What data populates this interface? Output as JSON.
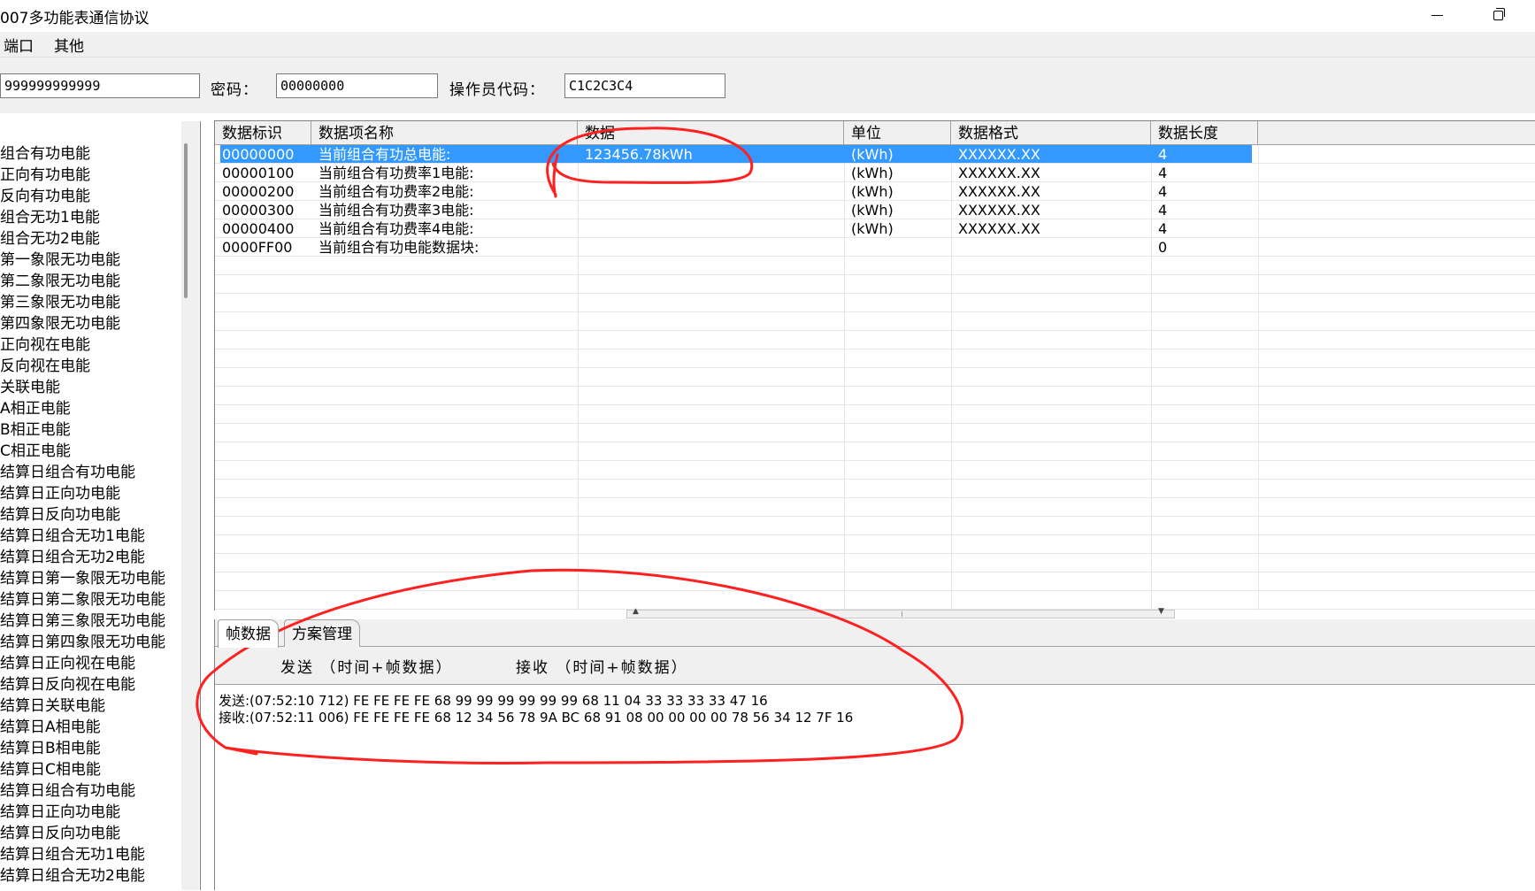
{
  "window": {
    "title": "007多功能表通信协议",
    "minimize_icon": "minimize-icon",
    "restore_icon": "restore-icon"
  },
  "menu": [
    "端口",
    "其他"
  ],
  "toolbar": {
    "address_value": "999999999999",
    "password_label": "密码：",
    "password_value": "00000000",
    "operator_label": "操作员代码：",
    "operator_value": "C1C2C3C4"
  },
  "tree": [
    "组合有功电能",
    "正向有功电能",
    "反向有功电能",
    "组合无功1电能",
    "组合无功2电能",
    "第一象限无功电能",
    "第二象限无功电能",
    "第三象限无功电能",
    "第四象限无功电能",
    "正向视在电能",
    "反向视在电能",
    "关联电能",
    "A相正电能",
    "B相正电能",
    "C相正电能",
    "结算日组合有功电能",
    "结算日正向功电能",
    "结算日反向功电能",
    "结算日组合无功1电能",
    "结算日组合无功2电能",
    "结算日第一象限无功电能",
    "结算日第二象限无功电能",
    "结算日第三象限无功电能",
    "结算日第四象限无功电能",
    "结算日正向视在电能",
    "结算日反向视在电能",
    "结算日关联电能",
    "结算日A相电能",
    "结算日B相电能",
    "结算日C相电能",
    "结算日组合有功电能",
    "结算日正向功电能",
    "结算日反向功电能",
    "结算日组合无功1电能",
    "结算日组合无功2电能"
  ],
  "grid": {
    "headers": [
      "数据标识",
      "数据项名称",
      "数据",
      "单位",
      "数据格式",
      "数据长度"
    ],
    "rows": [
      {
        "id": "00000000",
        "name": "当前组合有功总电能:",
        "data": "123456.78kWh",
        "unit": "(kWh)",
        "format": "XXXXXX.XX",
        "length": "4",
        "selected": true
      },
      {
        "id": "00000100",
        "name": "当前组合有功费率1电能:",
        "data": "",
        "unit": "(kWh)",
        "format": "XXXXXX.XX",
        "length": "4",
        "selected": false
      },
      {
        "id": "00000200",
        "name": "当前组合有功费率2电能:",
        "data": "",
        "unit": "(kWh)",
        "format": "XXXXXX.XX",
        "length": "4",
        "selected": false
      },
      {
        "id": "00000300",
        "name": "当前组合有功费率3电能:",
        "data": "",
        "unit": "(kWh)",
        "format": "XXXXXX.XX",
        "length": "4",
        "selected": false
      },
      {
        "id": "00000400",
        "name": "当前组合有功费率4电能:",
        "data": "",
        "unit": "(kWh)",
        "format": "XXXXXX.XX",
        "length": "4",
        "selected": false
      },
      {
        "id": "0000FF00",
        "name": "当前组合有功电能数据块:",
        "data": "",
        "unit": "",
        "format": "",
        "length": "0",
        "selected": false
      }
    ]
  },
  "tabs": [
    "帧数据",
    "方案管理"
  ],
  "log": {
    "send_header": "发送 （时间+帧数据）",
    "recv_header": "接收 （时间+帧数据）",
    "lines": [
      "发送:(07:52:10 712)  FE FE FE FE 68 99 99 99 99 99 99 68 11 04 33 33 33 33 47 16",
      "接收:(07:52:11 006)  FE FE FE FE 68 12 34 56 78 9A BC 68 91 08 00 00 00 00 78 56 34 12 7F 16"
    ]
  },
  "colors": {
    "selection": "#3399ff",
    "annotation": "#ff2020",
    "chrome": "#f0f0f0"
  }
}
